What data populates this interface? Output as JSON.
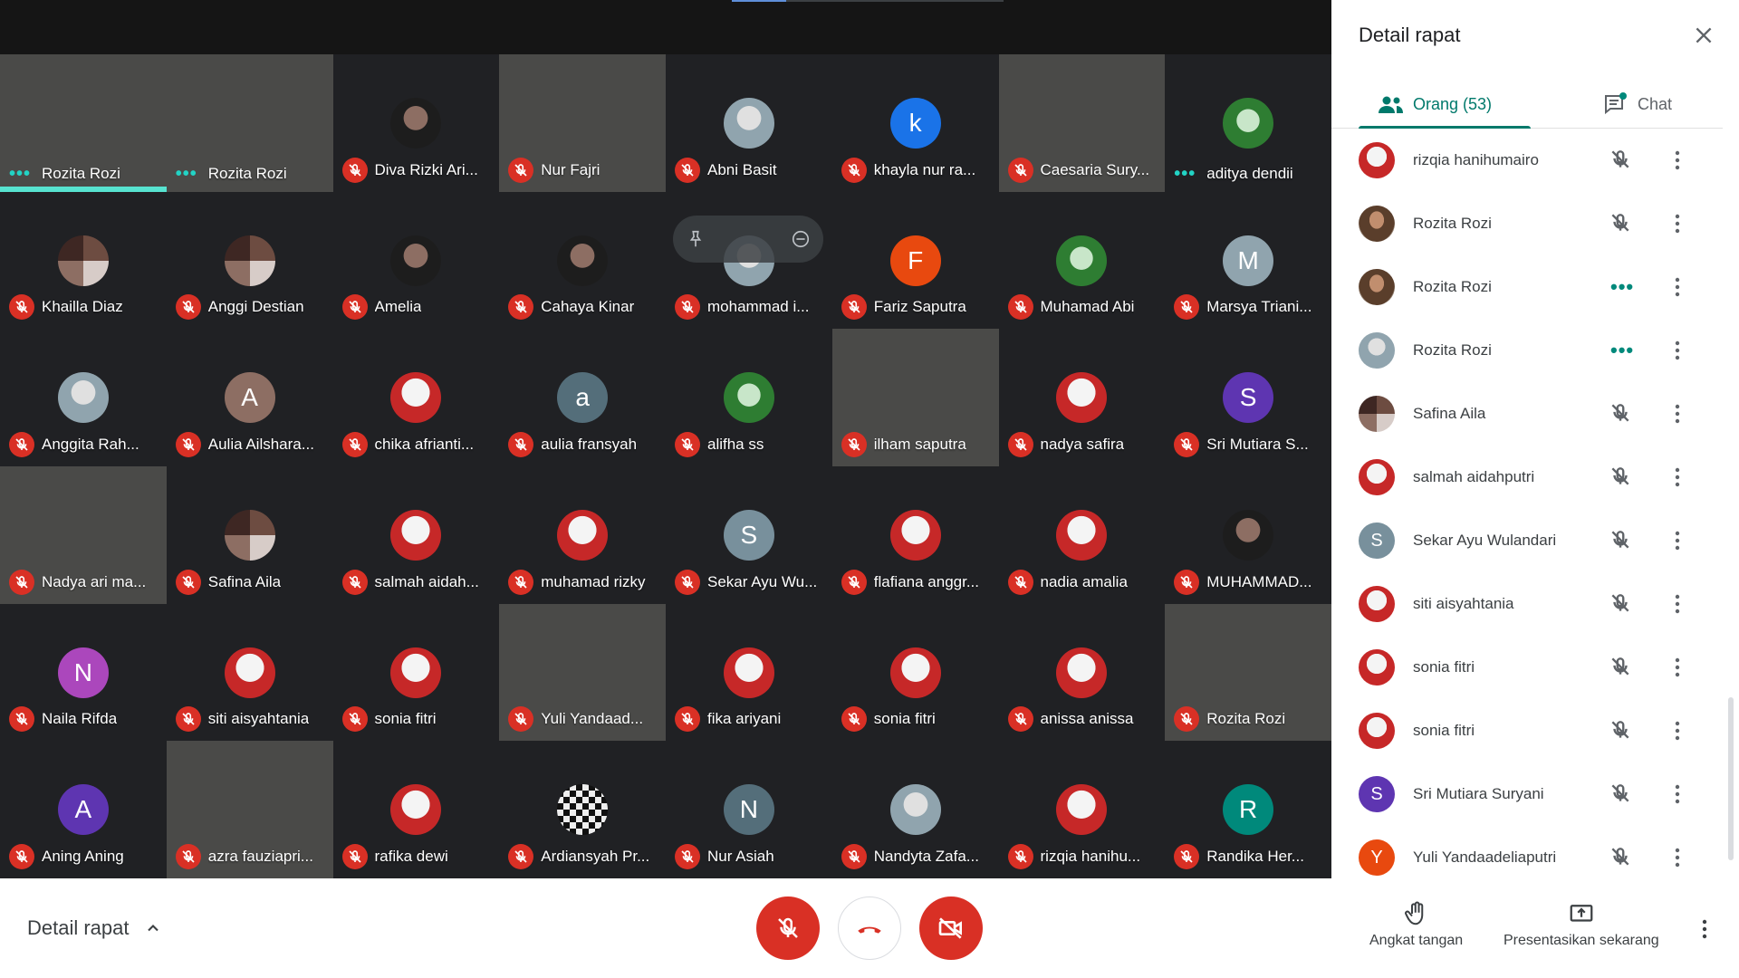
{
  "grid": {
    "tiles": [
      {
        "name": "Rozita Rozi",
        "kind": "video",
        "vid": "vid-hijab",
        "status": "dots",
        "speaking": true
      },
      {
        "name": "Rozita Rozi",
        "kind": "video",
        "vid": "vid-hijab",
        "status": "dots"
      },
      {
        "name": "Diva Rizki Ari...",
        "kind": "avatar",
        "av": "photo-dark",
        "status": "muted"
      },
      {
        "name": "Nur Fajri",
        "kind": "video",
        "vid": "vid-room",
        "status": "muted"
      },
      {
        "name": "Abni Basit",
        "kind": "avatar",
        "av": "photo-grey",
        "status": "muted"
      },
      {
        "name": "khayla nur ra...",
        "kind": "avatar",
        "letter": "k",
        "color": "#1a73e8",
        "status": "muted"
      },
      {
        "name": "Caesaria Sury...",
        "kind": "video",
        "vid": "vid-girl",
        "status": "muted"
      },
      {
        "name": "aditya dendii",
        "kind": "avatar",
        "av": "photo-green",
        "status": "dots"
      },
      {
        "name": "Khailla Diaz",
        "kind": "avatar",
        "av": "photo-multi",
        "status": "muted"
      },
      {
        "name": "Anggi Destian",
        "kind": "avatar",
        "av": "photo-multi",
        "status": "muted"
      },
      {
        "name": "Amelia",
        "kind": "avatar",
        "av": "photo-dark",
        "status": "muted"
      },
      {
        "name": "Cahaya Kinar",
        "kind": "avatar",
        "av": "photo-dark",
        "status": "muted"
      },
      {
        "name": "mohammad i...",
        "kind": "avatar",
        "av": "photo-grey",
        "status": "muted",
        "hover": true
      },
      {
        "name": "Fariz Saputra",
        "kind": "avatar",
        "letter": "F",
        "color": "#e8490f",
        "status": "muted"
      },
      {
        "name": "Muhamad Abi",
        "kind": "avatar",
        "av": "photo-green",
        "status": "muted"
      },
      {
        "name": "Marsya Triani...",
        "kind": "avatar",
        "letter": "M",
        "color": "#90a4ae",
        "status": "muted"
      },
      {
        "name": "Anggita Rah...",
        "kind": "avatar",
        "av": "photo-grey",
        "status": "muted"
      },
      {
        "name": "Aulia Ailshara...",
        "kind": "avatar",
        "letter": "A",
        "color": "#8d6e63",
        "status": "muted"
      },
      {
        "name": "chika afrianti...",
        "kind": "avatar",
        "av": "photo-av",
        "status": "muted"
      },
      {
        "name": "aulia fransyah",
        "kind": "avatar",
        "letter": "a",
        "color": "#546e7a",
        "status": "muted"
      },
      {
        "name": "alifha ss",
        "kind": "avatar",
        "av": "photo-green",
        "status": "muted"
      },
      {
        "name": "ilham saputra",
        "kind": "video",
        "vid": "vid-face",
        "status": "muted"
      },
      {
        "name": "nadya safira",
        "kind": "avatar",
        "av": "photo-av",
        "status": "muted"
      },
      {
        "name": "Sri Mutiara S...",
        "kind": "avatar",
        "letter": "S",
        "color": "#5e35b1",
        "status": "muted"
      },
      {
        "name": "Nadya ari ma...",
        "kind": "video",
        "vid": "vid-face",
        "status": "muted"
      },
      {
        "name": "Safina Aila",
        "kind": "avatar",
        "av": "photo-multi",
        "status": "muted"
      },
      {
        "name": "salmah aidah...",
        "kind": "avatar",
        "av": "photo-av",
        "status": "muted"
      },
      {
        "name": "muhamad rizky",
        "kind": "avatar",
        "av": "photo-av",
        "status": "muted"
      },
      {
        "name": "Sekar Ayu Wu...",
        "kind": "avatar",
        "letter": "S",
        "color": "#78909c",
        "status": "muted"
      },
      {
        "name": "flafiana anggr...",
        "kind": "avatar",
        "av": "photo-av",
        "status": "muted"
      },
      {
        "name": "nadia amalia",
        "kind": "avatar",
        "av": "photo-av",
        "status": "muted"
      },
      {
        "name": "MUHAMMAD...",
        "kind": "avatar",
        "av": "photo-dark",
        "status": "muted"
      },
      {
        "name": "Naila Rifda",
        "kind": "avatar",
        "letter": "N",
        "color": "#ab47bc",
        "status": "muted"
      },
      {
        "name": "siti aisyahtania",
        "kind": "avatar",
        "av": "photo-av",
        "status": "muted"
      },
      {
        "name": "sonia fitri",
        "kind": "avatar",
        "av": "photo-av",
        "status": "muted"
      },
      {
        "name": "Yuli Yandaad...",
        "kind": "video",
        "vid": "vid-girl",
        "status": "muted"
      },
      {
        "name": "fika ariyani",
        "kind": "avatar",
        "av": "photo-av",
        "status": "muted"
      },
      {
        "name": "sonia fitri",
        "kind": "avatar",
        "av": "photo-av",
        "status": "muted"
      },
      {
        "name": "anissa anissa",
        "kind": "avatar",
        "av": "photo-av",
        "status": "muted"
      },
      {
        "name": "Rozita Rozi",
        "kind": "video",
        "vid": "vid-hijab",
        "status": "muted"
      },
      {
        "name": "Aning Aning",
        "kind": "avatar",
        "letter": "A",
        "color": "#5e35b1",
        "status": "muted"
      },
      {
        "name": "azra fauziapri...",
        "kind": "video",
        "vid": "vid-sky",
        "status": "muted"
      },
      {
        "name": "rafika dewi",
        "kind": "avatar",
        "av": "photo-av",
        "status": "muted"
      },
      {
        "name": "Ardiansyah Pr...",
        "kind": "avatar",
        "av": "photo-check",
        "status": "muted"
      },
      {
        "name": "Nur Asiah",
        "kind": "avatar",
        "letter": "N",
        "color": "#546e7a",
        "status": "muted"
      },
      {
        "name": "Nandyta Zafa...",
        "kind": "avatar",
        "av": "photo-grey",
        "status": "muted"
      },
      {
        "name": "rizqia hanihu...",
        "kind": "avatar",
        "av": "photo-av",
        "status": "muted"
      },
      {
        "name": "Randika Her...",
        "kind": "avatar",
        "letter": "R",
        "color": "#00897b",
        "status": "muted"
      }
    ]
  },
  "bottom": {
    "meeting_details_label": "Detail rapat",
    "raise_hand_label": "Angkat tangan",
    "present_label": "Presentasikan sekarang"
  },
  "panel": {
    "title": "Detail rapat",
    "people_tab_label": "Orang (53)",
    "chat_tab_label": "Chat",
    "people": [
      {
        "name": "rizqia hanihumairo",
        "av": "photo-av",
        "status": "muted"
      },
      {
        "name": "Rozita Rozi",
        "av": "vid-hijab",
        "status": "muted"
      },
      {
        "name": "Rozita Rozi",
        "av": "vid-hijab",
        "status": "dots"
      },
      {
        "name": "Rozita Rozi",
        "av": "photo-grey",
        "status": "dots"
      },
      {
        "name": "Safina Aila",
        "av": "photo-multi",
        "status": "muted"
      },
      {
        "name": "salmah aidahputri",
        "av": "photo-av",
        "status": "muted"
      },
      {
        "name": "Sekar Ayu Wulandari",
        "letter": "S",
        "color": "#78909c",
        "status": "muted"
      },
      {
        "name": "siti aisyahtania",
        "av": "photo-av",
        "status": "muted"
      },
      {
        "name": "sonia fitri",
        "av": "photo-av",
        "status": "muted"
      },
      {
        "name": "sonia fitri",
        "av": "photo-av",
        "status": "muted"
      },
      {
        "name": "Sri Mutiara Suryani",
        "letter": "S",
        "color": "#5e35b1",
        "status": "muted"
      },
      {
        "name": "Yuli Yandaadeliaputri",
        "letter": "Y",
        "color": "#e8490f",
        "status": "muted"
      }
    ]
  },
  "colors": {
    "accent": "#00796b",
    "danger": "#d93025",
    "speaking": "#57e3d0"
  },
  "icons": [
    "mic-off-icon",
    "dots-icon",
    "close-icon",
    "people-icon",
    "chat-icon",
    "raise-hand-icon",
    "present-icon",
    "more-vert-icon",
    "end-call-icon",
    "camera-off-icon",
    "chevron-up-icon",
    "pin-icon",
    "remove-icon"
  ]
}
